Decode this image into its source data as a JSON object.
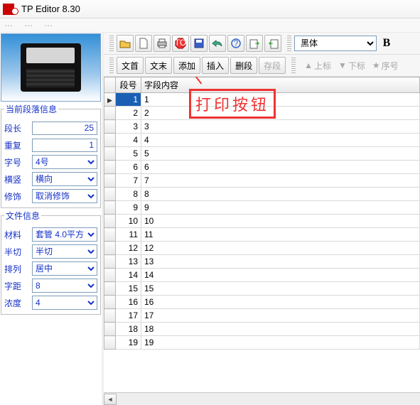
{
  "title": "TP Editor  8.30",
  "menu_placeholders": [
    "",
    "",
    "",
    ""
  ],
  "toolbar_text_buttons": {
    "doc_start": "文首",
    "doc_end": "文末",
    "add": "添加",
    "insert": "插入",
    "delete_seg": "删段",
    "save_seg": "存段"
  },
  "font_select": "黑体",
  "bold_glyph": "B",
  "star_items": {
    "sup": "上标",
    "sub": "下标",
    "seq": "序号"
  },
  "paragraph_info": {
    "legend": "当前段落信息",
    "len_label": "段长",
    "len_value": "25",
    "repeat_label": "重复",
    "repeat_value": "1",
    "font_label": "字号",
    "font_value": "4号",
    "orient_label": "横竖",
    "orient_value": "横向",
    "decor_label": "修饰",
    "decor_value": "取消修饰"
  },
  "file_info": {
    "legend": "文件信息",
    "material_label": "材料",
    "material_value": "套管 4.0平方",
    "cut_label": "半切",
    "cut_value": "半切",
    "arrange_label": "排列",
    "arrange_value": "居中",
    "spacing_label": "字距",
    "spacing_value": "8",
    "density_label": "浓度",
    "density_value": "4"
  },
  "table": {
    "col_num": "段号",
    "col_content": "字段内容",
    "rows": [
      {
        "n": 1,
        "c": "1",
        "sel": true
      },
      {
        "n": 2,
        "c": "2"
      },
      {
        "n": 3,
        "c": "3"
      },
      {
        "n": 4,
        "c": "4"
      },
      {
        "n": 5,
        "c": "5"
      },
      {
        "n": 6,
        "c": "6"
      },
      {
        "n": 7,
        "c": "7"
      },
      {
        "n": 8,
        "c": "8"
      },
      {
        "n": 9,
        "c": "9"
      },
      {
        "n": 10,
        "c": "10"
      },
      {
        "n": 11,
        "c": "11"
      },
      {
        "n": 12,
        "c": "12"
      },
      {
        "n": 13,
        "c": "13"
      },
      {
        "n": 14,
        "c": "14"
      },
      {
        "n": 15,
        "c": "15"
      },
      {
        "n": 16,
        "c": "16"
      },
      {
        "n": 17,
        "c": "17"
      },
      {
        "n": 18,
        "c": "18"
      },
      {
        "n": 19,
        "c": "19"
      }
    ]
  },
  "callout_text": "打印按钮"
}
